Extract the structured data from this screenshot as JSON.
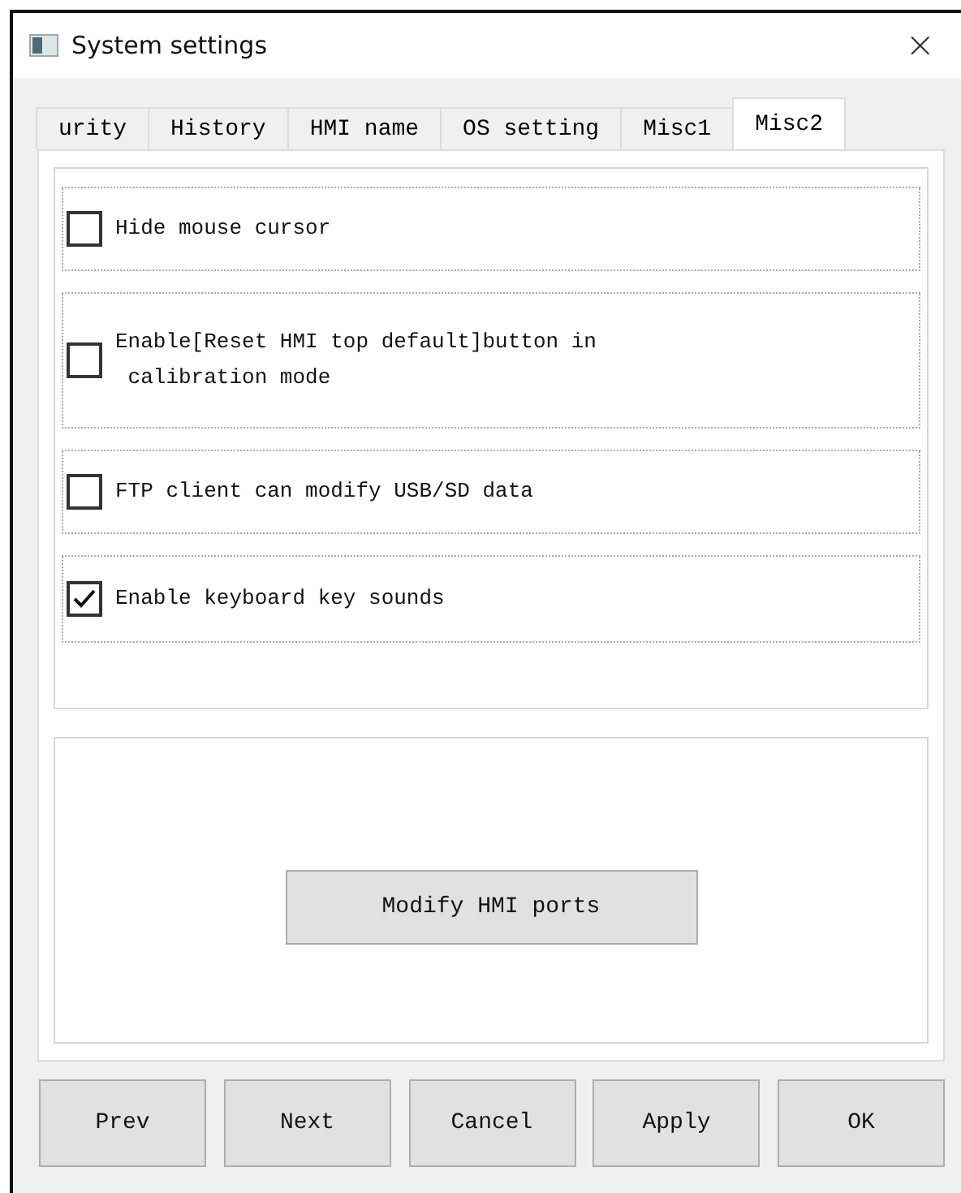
{
  "window": {
    "title": "System settings",
    "close": "×"
  },
  "tabs": [
    {
      "label": "urity",
      "selected": false
    },
    {
      "label": "History",
      "selected": false
    },
    {
      "label": "HMI name",
      "selected": false
    },
    {
      "label": "OS setting",
      "selected": false
    },
    {
      "label": "Misc1",
      "selected": false
    },
    {
      "label": "Misc2",
      "selected": true
    }
  ],
  "options": [
    {
      "label": "Hide mouse cursor",
      "checked": false
    },
    {
      "label": "Enable[Reset HMI top default]button in\n calibration mode",
      "checked": false
    },
    {
      "label": "FTP client can modify USB/SD data",
      "checked": false
    },
    {
      "label": "Enable keyboard key sounds",
      "checked": true
    }
  ],
  "port_button": "Modify HMI ports",
  "buttons": [
    "Prev",
    "Next",
    "Cancel",
    "Apply",
    "OK"
  ]
}
